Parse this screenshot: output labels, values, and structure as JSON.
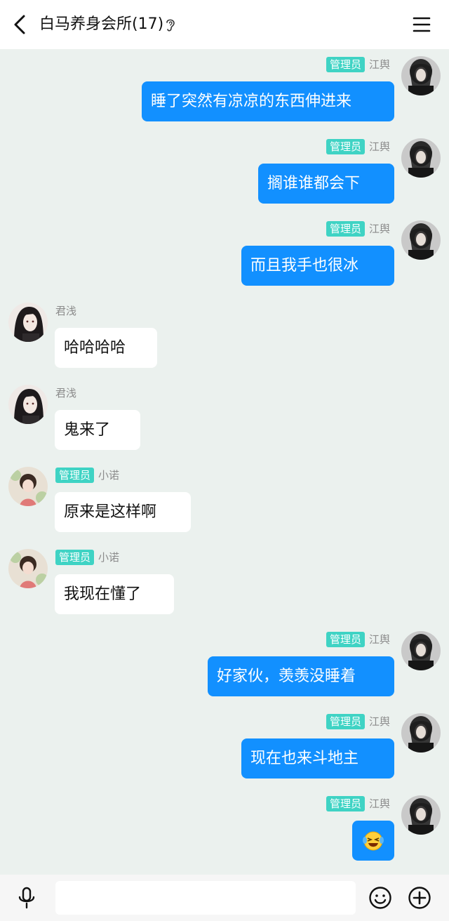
{
  "header": {
    "title": "白马养身会所(17)",
    "back_icon": "chevron-left-icon",
    "ear_icon": "ear-icon",
    "menu_icon": "menu-icon"
  },
  "badge_color": "#3fd3c4",
  "outgoing_bubble_color": "#1290ff",
  "messages": [
    {
      "side": "right",
      "sender": "江舆",
      "badge": "管理员",
      "text": "睡了突然有凉凉的东西伸进来"
    },
    {
      "side": "right",
      "sender": "江舆",
      "badge": "管理员",
      "text": "搁谁谁都会下"
    },
    {
      "side": "right",
      "sender": "江舆",
      "badge": "管理员",
      "text": "而且我手也很冰"
    },
    {
      "side": "left",
      "sender": "君浅",
      "text": "哈哈哈哈"
    },
    {
      "side": "left",
      "sender": "君浅",
      "text": "鬼来了"
    },
    {
      "side": "left",
      "sender": "小诺",
      "badge": "管理员",
      "text": "原来是这样啊"
    },
    {
      "side": "left",
      "sender": "小诺",
      "badge": "管理员",
      "text": "我现在懂了"
    },
    {
      "side": "right",
      "sender": "江舆",
      "badge": "管理员",
      "text": "好家伙，羡羡没睡着"
    },
    {
      "side": "right",
      "sender": "江舆",
      "badge": "管理员",
      "text": "现在也来斗地主"
    },
    {
      "side": "right",
      "sender": "江舆",
      "badge": "管理员",
      "emoji": "laughing-crying-emoji"
    }
  ],
  "footer": {
    "input_placeholder": "",
    "mic_icon": "mic-icon",
    "emoji_icon": "smiley-icon",
    "plus_icon": "plus-circle-icon"
  }
}
